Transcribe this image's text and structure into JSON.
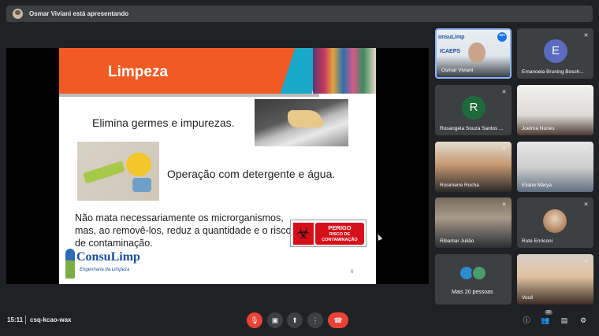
{
  "presenter": {
    "text": "Osmar Viviani está apresentando"
  },
  "slide": {
    "title": "Limpeza",
    "line1": "Elimina germes e impurezas.",
    "line2": "Operação com detergente e água.",
    "line3": "Não mata necessariamente os microrganismos, mas, ao removê-los, reduz a quantidade e o risco de contaminação.",
    "sign_line1": "PERIGO",
    "sign_line2": "RISCO DE CONTAMINAÇÃO",
    "logo_brand": "ConsuLimp",
    "logo_sub": "Engenharia da Limpeza",
    "page": "6"
  },
  "participants": [
    {
      "name": "Osmar Viviani",
      "initial": "",
      "speaking": true
    },
    {
      "name": "Emanoela Bruning Bosch...",
      "initial": "E",
      "color": "#5c6bc0"
    },
    {
      "name": "Rosangela Souza Santos ...",
      "initial": "R",
      "color": "#1e6b3a"
    },
    {
      "name": "Joelma Nunes",
      "initial": ""
    },
    {
      "name": "Rosimeire Rocha",
      "initial": ""
    },
    {
      "name": "Eliane Marya",
      "initial": ""
    },
    {
      "name": "Ribamar Julião",
      "initial": ""
    },
    {
      "name": "Rute Enriconi",
      "initial": ""
    },
    {
      "name": "Mais 20 pessoas",
      "initial": ""
    },
    {
      "name": "Você",
      "initial": ""
    }
  ],
  "meeting": {
    "time": "15:11",
    "code": "csq-kcao-wax",
    "participant_count": "30"
  },
  "icons": {
    "mic_off": "mic-off-icon",
    "camera": "camera-icon",
    "present": "present-icon",
    "more": "more-options-icon",
    "hangup": "hang-up-icon",
    "info": "info-icon",
    "people": "people-icon",
    "chat": "chat-icon",
    "activities": "activities-icon"
  },
  "colors": {
    "accent": "#1a73e8",
    "danger": "#ea4335",
    "slide_band": "#f15a24",
    "background": "#202124"
  }
}
